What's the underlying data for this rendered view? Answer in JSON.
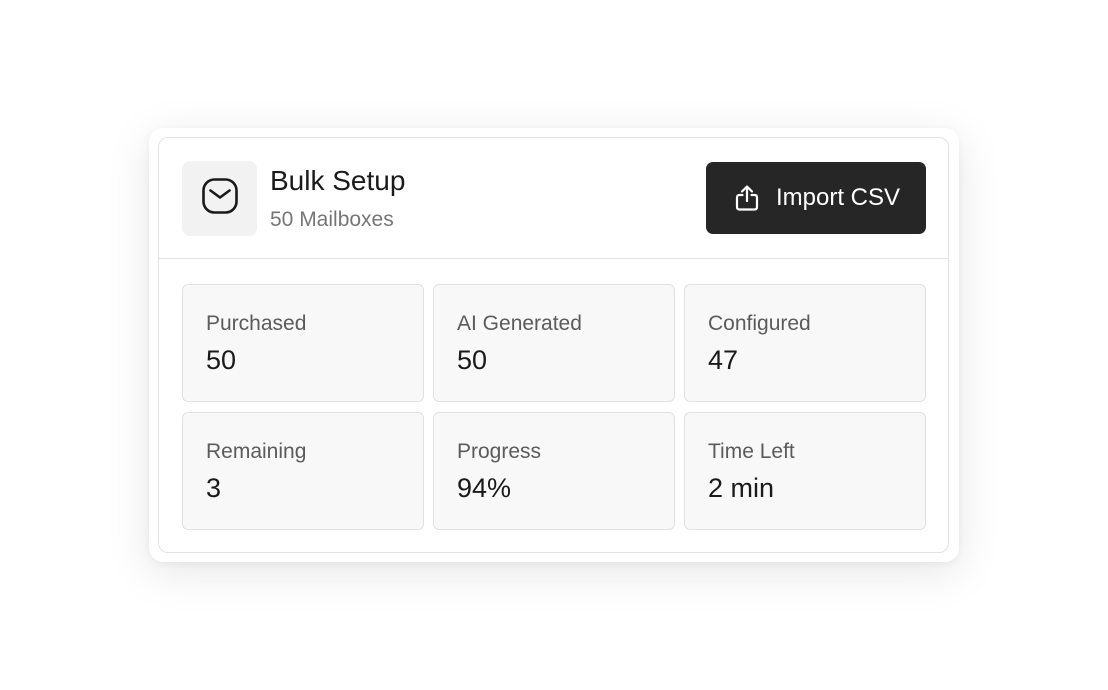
{
  "header": {
    "icon": "mail-icon",
    "title": "Bulk Setup",
    "subtitle": "50 Mailboxes",
    "import_button": {
      "label": "Import CSV",
      "icon": "upload-icon"
    }
  },
  "stats": [
    {
      "label": "Purchased",
      "value": "50"
    },
    {
      "label": "AI Generated",
      "value": "50"
    },
    {
      "label": "Configured",
      "value": "47"
    },
    {
      "label": "Remaining",
      "value": "3"
    },
    {
      "label": "Progress",
      "value": "94%"
    },
    {
      "label": "Time Left",
      "value": "2 min"
    }
  ],
  "colors": {
    "button_bg": "#262626",
    "card_bg": "#f8f8f8",
    "border": "#e3e3e3"
  }
}
